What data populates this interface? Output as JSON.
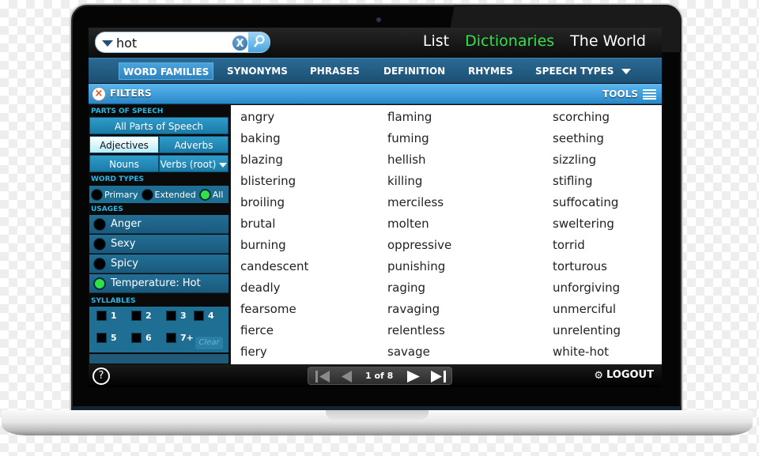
{
  "search": {
    "value": "hot",
    "clear_icon": "clear-x-icon",
    "search_icon": "magnifier-icon"
  },
  "topnav": [
    {
      "label": "List",
      "active": false
    },
    {
      "label": "Dictionaries",
      "active": true
    },
    {
      "label": "The World",
      "active": false
    }
  ],
  "tabs": [
    {
      "label": "WORD FAMILIES",
      "active": true
    },
    {
      "label": "SYNONYMS",
      "active": false
    },
    {
      "label": "PHRASES",
      "active": false
    },
    {
      "label": "DEFINITION",
      "active": false
    },
    {
      "label": "RHYMES",
      "active": false
    },
    {
      "label": "SPEECH TYPES",
      "active": false,
      "dropdown": true
    }
  ],
  "filterbar": {
    "filters_label": "FILTERS",
    "tools_label": "TOOLS"
  },
  "sidebar": {
    "parts_heading": "PARTS OF SPEECH",
    "all_parts": "All Parts of Speech",
    "parts": [
      {
        "label": "Adjectives",
        "selected": true
      },
      {
        "label": "Adverbs",
        "selected": false
      },
      {
        "label": "Nouns",
        "selected": false
      },
      {
        "label": "Verbs (root)",
        "selected": false,
        "dropdown": true
      }
    ],
    "word_types_heading": "WORD TYPES",
    "word_types": [
      {
        "label": "Primary",
        "on": false
      },
      {
        "label": "Extended",
        "on": false
      },
      {
        "label": "All",
        "on": true
      }
    ],
    "usages_heading": "USAGES",
    "usages": [
      {
        "label": "Anger",
        "on": false
      },
      {
        "label": "Sexy",
        "on": false
      },
      {
        "label": "Spicy",
        "on": false
      },
      {
        "label": "Temperature: Hot",
        "on": true
      }
    ],
    "syllables_heading": "SYLLABLES",
    "syllables": [
      "1",
      "2",
      "3",
      "4",
      "5",
      "6",
      "7+"
    ],
    "clear_label": "Clear"
  },
  "results": {
    "columns": [
      [
        "angry",
        "baking",
        "blazing",
        "blistering",
        "broiling",
        "brutal",
        "burning",
        "candescent",
        "deadly",
        "fearsome",
        "fierce",
        "fiery"
      ],
      [
        "flaming",
        "fuming",
        "hellish",
        "killing",
        "merciless",
        "molten",
        "oppressive",
        "punishing",
        "raging",
        "ravaging",
        "relentless",
        "savage"
      ],
      [
        "scorching",
        "seething",
        "sizzling",
        "stifling",
        "suffocating",
        "sweltering",
        "torrid",
        "torturous",
        "unforgiving",
        "unmerciful",
        "unrelenting",
        "white-hot"
      ]
    ]
  },
  "footer": {
    "help": "?",
    "page_label": "1 of 8",
    "logout_label": "LOGOUT"
  },
  "colors": {
    "accent_green": "#33e04a",
    "tab_blue": "#1c4f73",
    "filter_blue": "#2a88c9",
    "heading_cyan": "#29b7e8"
  }
}
